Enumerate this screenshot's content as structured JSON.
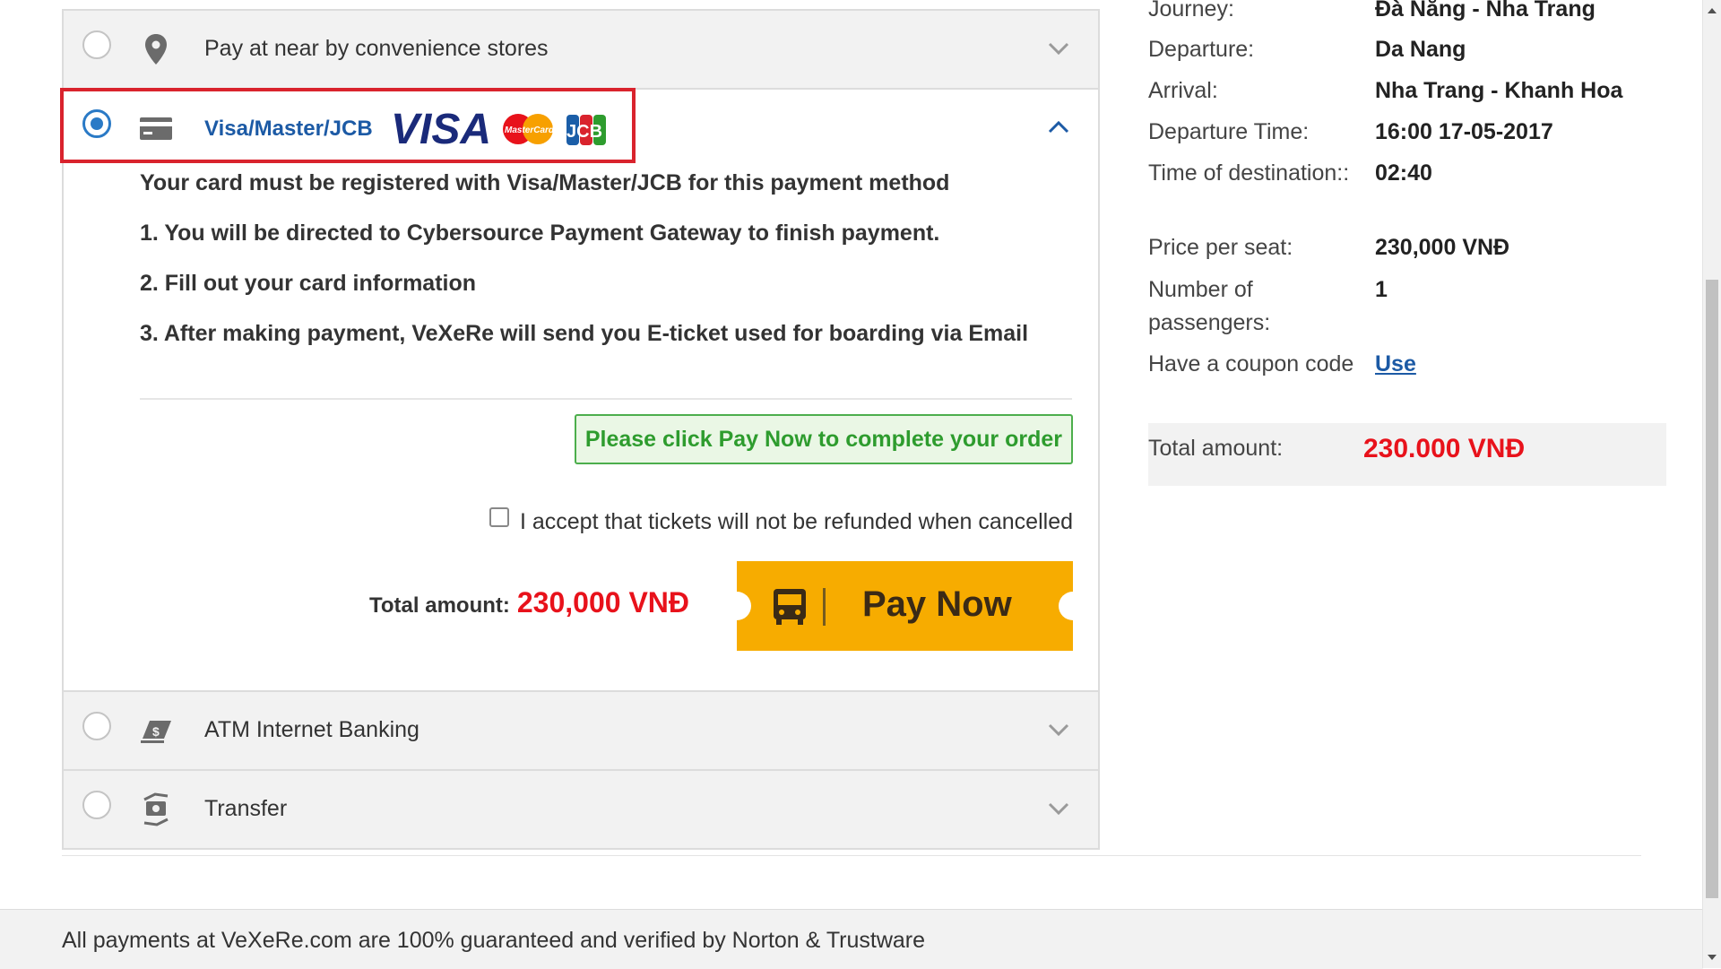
{
  "payment_options": [
    {
      "label": "Pay at near by convenience stores",
      "selected": false,
      "icon": "location-pin-icon"
    },
    {
      "label": "Visa/Master/JCB",
      "selected": true,
      "icon": "credit-card-icon"
    },
    {
      "label": "ATM Internet Banking",
      "selected": false,
      "icon": "atm-card-icon"
    },
    {
      "label": "Transfer",
      "selected": false,
      "icon": "transfer-icon"
    }
  ],
  "card_brands": [
    "VISA",
    "MasterCard",
    "JCB"
  ],
  "card_panel": {
    "intro": "Your card must be registered with Visa/Master/JCB for this payment method",
    "steps": [
      "1. You will be directed to Cybersource Payment Gateway to finish payment.",
      "2. Fill out your card information",
      "3. After making payment, VeXeRe will send you E-ticket used for boarding via Email"
    ],
    "notice": "Please click Pay Now to complete your order",
    "accept_label": "I accept that tickets will not be refunded when cancelled",
    "accept_checked": false,
    "total_label": "Total amount:",
    "total_value": "230,000 VNĐ",
    "pay_button": "Pay Now"
  },
  "summary": {
    "journey": {
      "label": "Journey:",
      "value": "Đà Nẵng - Nha Trang"
    },
    "departure": {
      "label": "Departure:",
      "value": "Da Nang"
    },
    "arrival": {
      "label": "Arrival:",
      "value": "Nha Trang - Khanh Hoa"
    },
    "departure_time": {
      "label": "Departure Time:",
      "value": "16:00 17-05-2017"
    },
    "time_of_destination": {
      "label": "Time of destination::",
      "value": "02:40"
    },
    "price_per_seat": {
      "label": "Price per seat:",
      "value": "230,000 VNĐ"
    },
    "passengers": {
      "label": "Number of passengers:",
      "value": "1"
    },
    "coupon": {
      "label": "Have a coupon code",
      "value": "Use"
    },
    "total": {
      "label": "Total amount:",
      "value": "230.000 VNĐ"
    }
  },
  "footer": {
    "text": "All payments at VeXeRe.com are 100% guaranteed and verified by Norton & Trustware"
  },
  "colors": {
    "accent_blue": "#2a7ac6",
    "price_red": "#e8121b",
    "pay_button": "#f7ac00",
    "notice_green": "#2e9c2e",
    "highlight_red": "#d9232d"
  }
}
